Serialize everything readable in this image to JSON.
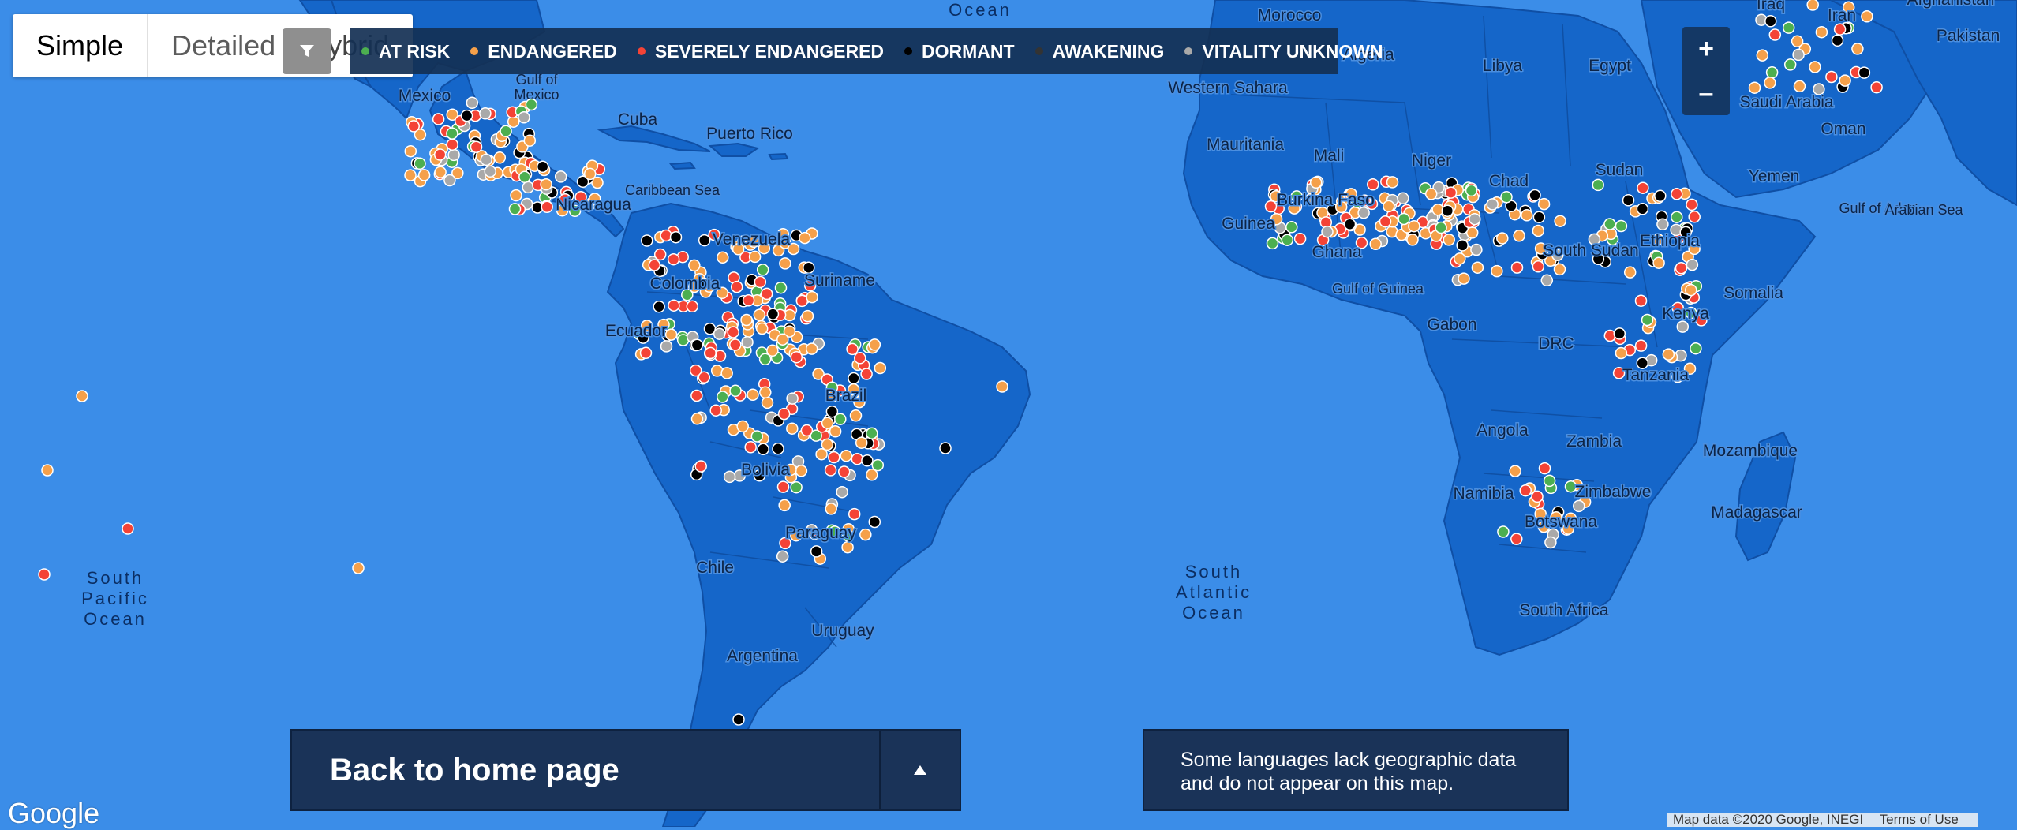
{
  "map_type": {
    "options": [
      "Simple",
      "Detailed",
      "Hybrid"
    ],
    "selected": "Simple"
  },
  "legend": [
    {
      "label": "AT RISK",
      "color": "#4caf50"
    },
    {
      "label": "ENDANGERED",
      "color": "#f5a04a"
    },
    {
      "label": "SEVERELY ENDANGERED",
      "color": "#f44336"
    },
    {
      "label": "DORMANT",
      "color": "#000000"
    },
    {
      "label": "AWAKENING",
      "color": "#333333"
    },
    {
      "label": "VITALITY UNKNOWN",
      "color": "#a9a9a9"
    }
  ],
  "zoom": {
    "in": "+",
    "out": "–"
  },
  "back_button": {
    "label": "Back to home page"
  },
  "notice": {
    "text": "Some languages lack geographic data and do not appear on this map."
  },
  "attribution": {
    "map_data": "Map data ©2020 Google, INEGI",
    "terms": "Terms of Use"
  },
  "google_logo": "Google",
  "map_labels": {
    "oceans": {
      "ocean_top": "Ocean",
      "south_pacific": [
        "South",
        "Pacific",
        "Ocean"
      ],
      "south_atlantic": [
        "South",
        "Atlantic",
        "Ocean"
      ],
      "caribbean": "Caribbean Sea",
      "gulf_mexico": [
        "Gulf of",
        "Mexico"
      ],
      "gulf_guinea": "Gulf of Guinea",
      "gulf_aden": "Gulf of Aden",
      "arabian_sea": "Arabian Sea"
    },
    "places": [
      "Mexico",
      "Cuba",
      "Puerto Rico",
      "Nicaragua",
      "Venezuela",
      "Colombia",
      "Suriname",
      "Ecuador",
      "Brazil",
      "Bolivia",
      "Paraguay",
      "Chile",
      "Uruguay",
      "Argentina",
      "Morocco",
      "Algeria",
      "Libya",
      "Egypt",
      "Western Sahara",
      "Mauritania",
      "Mali",
      "Niger",
      "Chad",
      "Sudan",
      "Burkina Faso",
      "Guinea",
      "Ghana",
      "Ethiopia",
      "South Sudan",
      "Gabon",
      "DRC",
      "Kenya",
      "Somalia",
      "Tanzania",
      "Angola",
      "Zambia",
      "Mozambique",
      "Namibia",
      "Zimbabwe",
      "Botswana",
      "Madagascar",
      "South Africa",
      "Iraq",
      "Iran",
      "Saudi Arabia",
      "Yemen",
      "Oman",
      "Afghanistan",
      "Pakistan"
    ]
  }
}
